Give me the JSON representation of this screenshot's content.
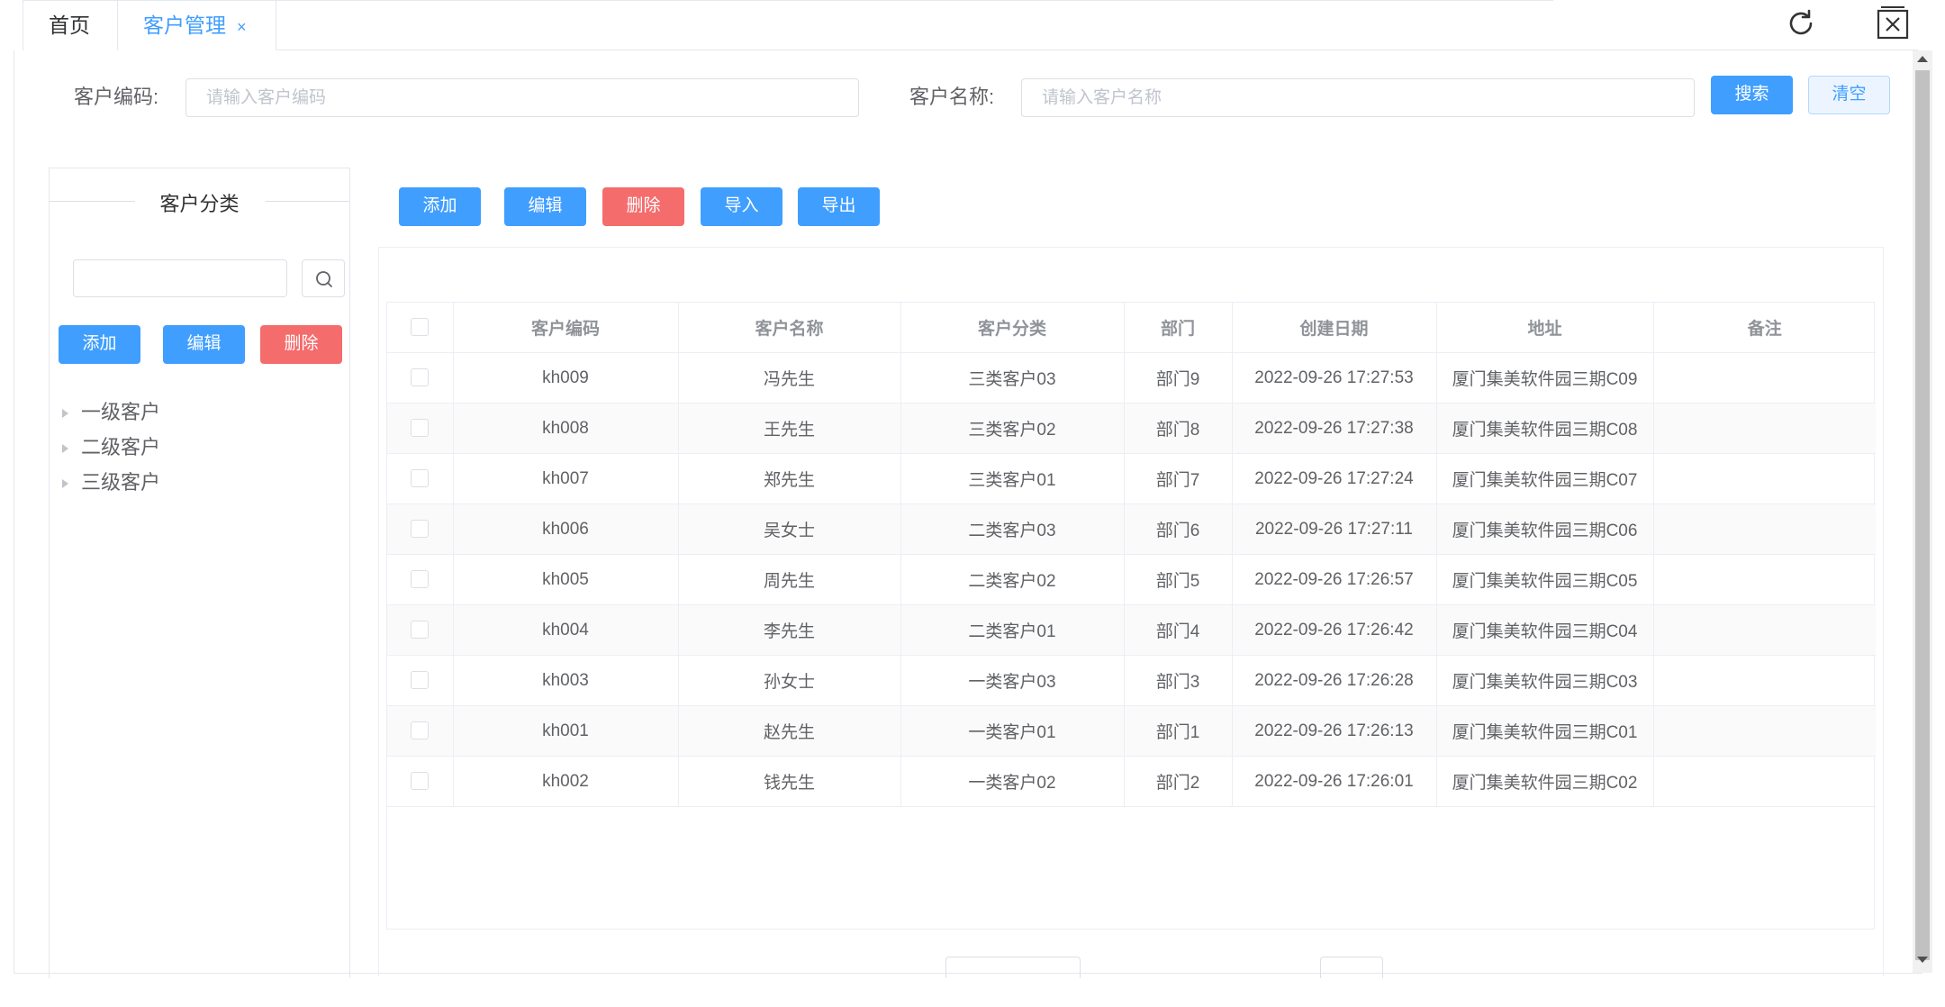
{
  "tabs": {
    "home": "首页",
    "customer": "客户管理",
    "close": "×"
  },
  "search": {
    "code_label": "客户编码:",
    "code_placeholder": "请输入客户编码",
    "name_label": "客户名称:",
    "name_placeholder": "请输入客户名称",
    "search_btn": "搜索",
    "clear_btn": "清空"
  },
  "category_panel": {
    "title": "客户分类",
    "add": "添加",
    "edit": "编辑",
    "delete": "删除",
    "nodes": [
      "一级客户",
      "二级客户",
      "三级客户"
    ]
  },
  "toolbar": {
    "add": "添加",
    "edit": "编辑",
    "delete": "删除",
    "import": "导入",
    "export": "导出"
  },
  "table": {
    "headers": [
      "客户编码",
      "客户名称",
      "客户分类",
      "部门",
      "创建日期",
      "地址",
      "备注"
    ],
    "rows": [
      [
        "kh009",
        "冯先生",
        "三类客户03",
        "部门9",
        "2022-09-26 17:27:53",
        "厦门集美软件园三期C09",
        ""
      ],
      [
        "kh008",
        "王先生",
        "三类客户02",
        "部门8",
        "2022-09-26 17:27:38",
        "厦门集美软件园三期C08",
        ""
      ],
      [
        "kh007",
        "郑先生",
        "三类客户01",
        "部门7",
        "2022-09-26 17:27:24",
        "厦门集美软件园三期C07",
        ""
      ],
      [
        "kh006",
        "吴女士",
        "二类客户03",
        "部门6",
        "2022-09-26 17:27:11",
        "厦门集美软件园三期C06",
        ""
      ],
      [
        "kh005",
        "周先生",
        "二类客户02",
        "部门5",
        "2022-09-26 17:26:57",
        "厦门集美软件园三期C05",
        ""
      ],
      [
        "kh004",
        "李先生",
        "二类客户01",
        "部门4",
        "2022-09-26 17:26:42",
        "厦门集美软件园三期C04",
        ""
      ],
      [
        "kh003",
        "孙女士",
        "一类客户03",
        "部门3",
        "2022-09-26 17:26:28",
        "厦门集美软件园三期C03",
        ""
      ],
      [
        "kh001",
        "赵先生",
        "一类客户01",
        "部门1",
        "2022-09-26 17:26:13",
        "厦门集美软件园三期C01",
        ""
      ],
      [
        "kh002",
        "钱先生",
        "一类客户02",
        "部门2",
        "2022-09-26 17:26:01",
        "厦门集美软件园三期C02",
        ""
      ]
    ]
  },
  "colors": {
    "primary": "#409eff",
    "danger": "#f56c6c",
    "border": "#ebeef5"
  }
}
